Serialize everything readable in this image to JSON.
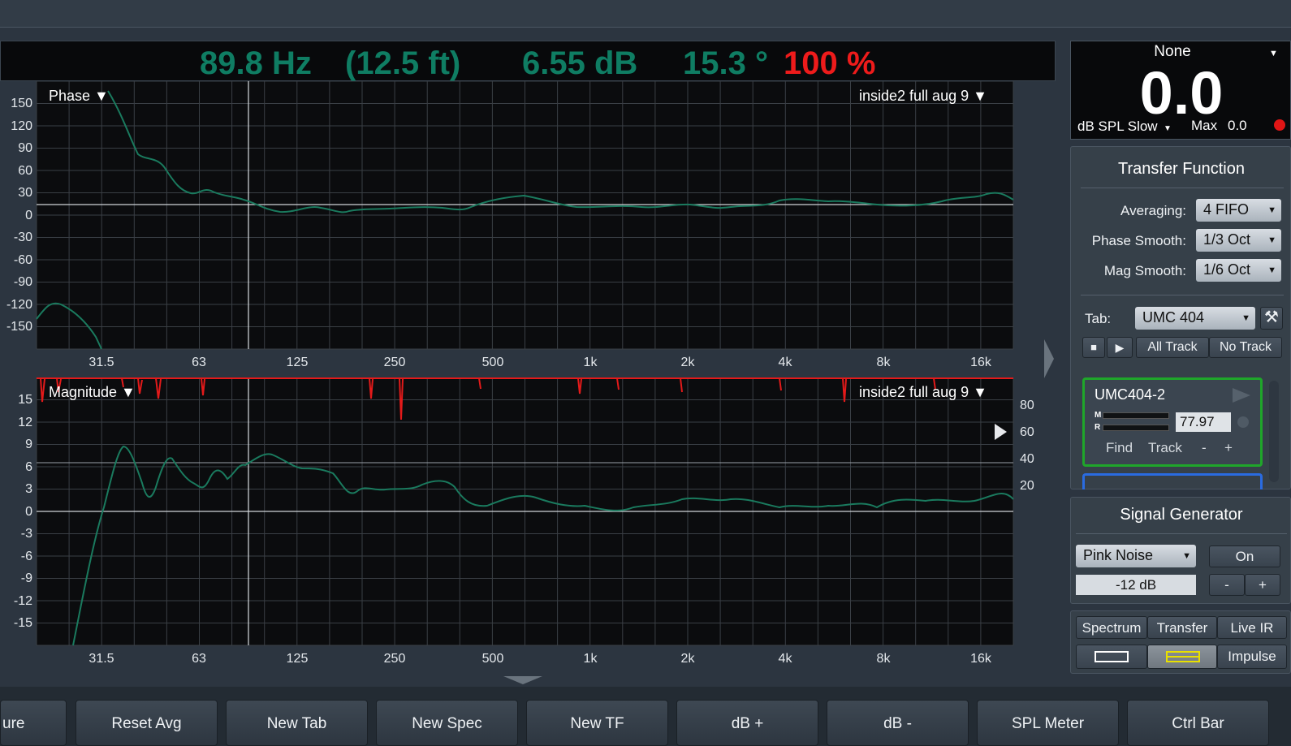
{
  "readout": {
    "frequency": "89.8 Hz",
    "distance": "(12.5 ft)",
    "magnitude": "6.55 dB",
    "phase": "15.3 °",
    "coherence": "100 %"
  },
  "phase_plot": {
    "title": "Phase ▼",
    "trace_label": "inside2 full aug 9 ▼",
    "y_ticks": [
      "150",
      "120",
      "90",
      "60",
      "30",
      "0",
      "-30",
      "-60",
      "-90",
      "-120",
      "-150"
    ],
    "x_ticks": [
      "31.5",
      "63",
      "125",
      "250",
      "500",
      "1k",
      "2k",
      "4k",
      "8k",
      "16k"
    ]
  },
  "mag_plot": {
    "title": "Magnitude ▼",
    "trace_label": "inside2 full aug 9 ▼",
    "y_ticks": [
      "15",
      "12",
      "9",
      "6",
      "3",
      "0",
      "-3",
      "-6",
      "-9",
      "-12",
      "-15"
    ],
    "x_ticks": [
      "31.5",
      "63",
      "125",
      "250",
      "500",
      "1k",
      "2k",
      "4k",
      "8k",
      "16k"
    ],
    "coherence_ticks": [
      "80",
      "60",
      "40",
      "20"
    ]
  },
  "spl_meter": {
    "source": "None",
    "value": "0.0",
    "mode": "dB SPL Slow",
    "max_label": "Max",
    "max_value": "0.0"
  },
  "transfer_function": {
    "title": "Transfer Function",
    "averaging_label": "Averaging:",
    "averaging_value": "4 FIFO",
    "phase_smooth_label": "Phase Smooth:",
    "phase_smooth_value": "1/3 Oct",
    "mag_smooth_label": "Mag Smooth:",
    "mag_smooth_value": "1/6 Oct",
    "tab_label": "Tab:",
    "tab_value": "UMC 404",
    "all_track": "All Track",
    "no_track": "No Track",
    "measurement": {
      "name": "UMC404-2",
      "meter_m": "M",
      "meter_r": "R",
      "delay": "77.97",
      "find": "Find",
      "track": "Track",
      "minus": "-",
      "plus": "+"
    }
  },
  "signal_generator": {
    "title": "Signal Generator",
    "type": "Pink Noise",
    "on": "On",
    "level": "-12 dB",
    "minus": "-",
    "plus": "+"
  },
  "view_modes": {
    "spectrum": "Spectrum",
    "transfer": "Transfer",
    "live_ir": "Live IR",
    "impulse": "Impulse"
  },
  "bottom_buttons": {
    "capture": "ure",
    "reset_avg": "Reset Avg",
    "new_tab": "New Tab",
    "new_spec": "New Spec",
    "new_tf": "New TF",
    "db_plus": "dB +",
    "db_minus": "dB -",
    "spl_meter": "SPL Meter",
    "ctrl_bar": "Ctrl Bar"
  },
  "colors": {
    "trace": "#1a7a5e",
    "coherence": "#e31a1a",
    "readout_green": "#0f7d63",
    "readout_red": "#ee1b1b",
    "measurement_border": "#1fa62a"
  }
}
